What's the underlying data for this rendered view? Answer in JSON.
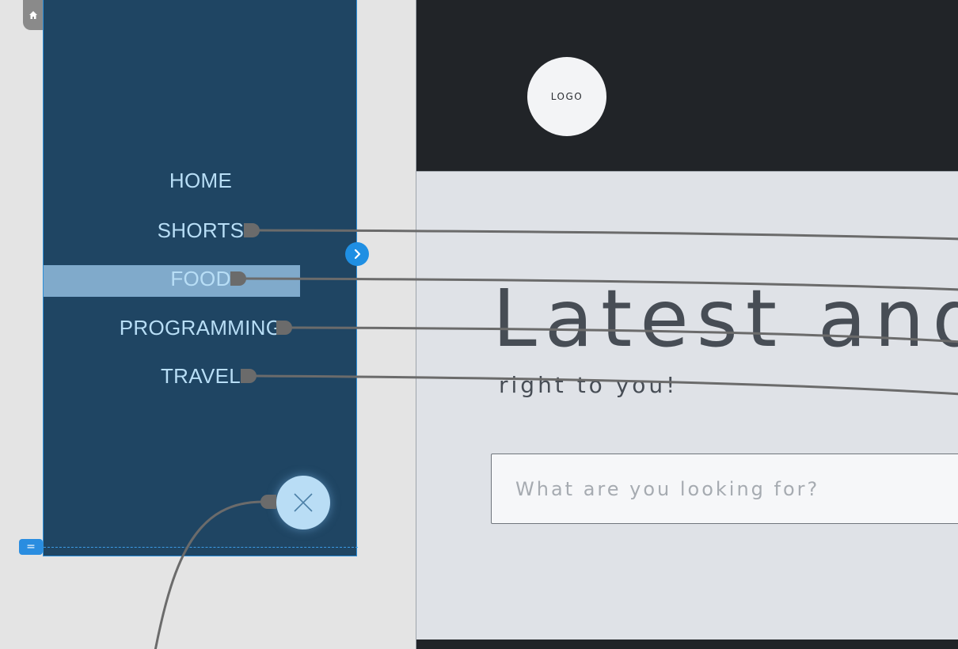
{
  "menu": {
    "items": [
      {
        "label": "HOME"
      },
      {
        "label": "SHORTS"
      },
      {
        "label": "FOOD"
      },
      {
        "label": "PROGRAMMING"
      },
      {
        "label": "TRAVEL"
      }
    ],
    "selected": "FOOD"
  },
  "page": {
    "logo": "LOGO",
    "hero_title": "Latest and",
    "hero_subtitle": "right to you!",
    "search_placeholder": "What are you looking for?"
  },
  "icons": {
    "home": "home-icon",
    "expand": "chevron-right-icon",
    "close": "close-icon",
    "fold": "fold-handle-icon"
  },
  "colors": {
    "menu_background": "#1f4563",
    "menu_text": "#b8def6",
    "selection_highlight": "#80aacb",
    "accent_blue": "#1f8fe3",
    "header_dark": "#212428",
    "connector": "#6b6b6b"
  }
}
